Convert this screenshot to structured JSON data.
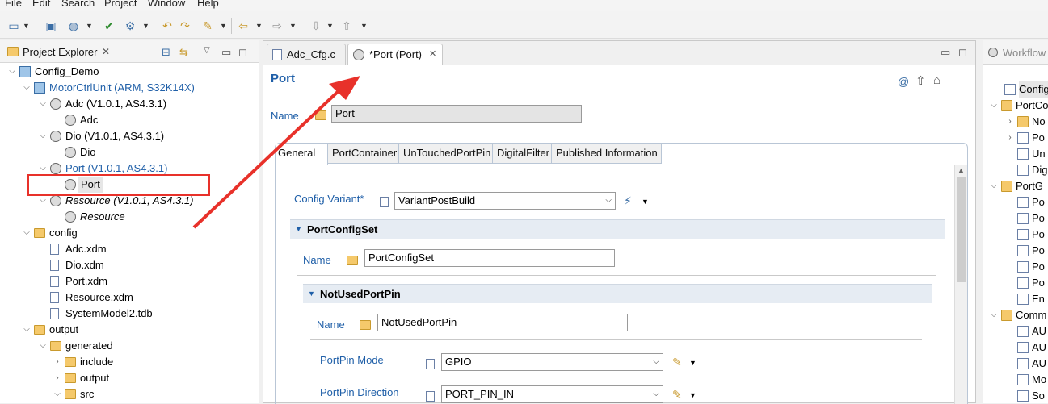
{
  "menu": [
    "File",
    "Edit",
    "Search",
    "Project",
    "Window",
    "Help"
  ],
  "project_explorer": {
    "title": "Project Explorer",
    "tree": [
      {
        "label": "Config_Demo",
        "depth": 0,
        "twisty": "open",
        "icon": "project",
        "color": "#000"
      },
      {
        "label": "MotorCtrlUnit (ARM, S32K14X)",
        "depth": 1,
        "twisty": "open",
        "icon": "ecu",
        "color": "#1f5fa8"
      },
      {
        "label": "Adc (V1.0.1, AS4.3.1)",
        "depth": 2,
        "twisty": "open",
        "icon": "module",
        "color": "#000"
      },
      {
        "label": "Adc",
        "depth": 3,
        "twisty": "",
        "icon": "config",
        "color": "#000"
      },
      {
        "label": "Dio (V1.0.1, AS4.3.1)",
        "depth": 2,
        "twisty": "open",
        "icon": "module",
        "color": "#000"
      },
      {
        "label": "Dio",
        "depth": 3,
        "twisty": "",
        "icon": "config",
        "color": "#000"
      },
      {
        "label": "Port (V1.0.1, AS4.3.1)",
        "depth": 2,
        "twisty": "open",
        "icon": "module",
        "color": "#1f5fa8"
      },
      {
        "label": "Port",
        "depth": 3,
        "twisty": "",
        "icon": "config",
        "color": "#000",
        "selected": true
      },
      {
        "label": "Resource (V1.0.1, AS4.3.1)",
        "depth": 2,
        "twisty": "open",
        "icon": "module",
        "color": "#000",
        "italic": true
      },
      {
        "label": "Resource",
        "depth": 3,
        "twisty": "",
        "icon": "config",
        "color": "#000",
        "italic": true
      },
      {
        "label": "config",
        "depth": 1,
        "twisty": "open",
        "icon": "folder",
        "color": "#000"
      },
      {
        "label": "Adc.xdm",
        "depth": 2,
        "twisty": "",
        "icon": "file",
        "color": "#000"
      },
      {
        "label": "Dio.xdm",
        "depth": 2,
        "twisty": "",
        "icon": "file",
        "color": "#000"
      },
      {
        "label": "Port.xdm",
        "depth": 2,
        "twisty": "",
        "icon": "file",
        "color": "#000"
      },
      {
        "label": "Resource.xdm",
        "depth": 2,
        "twisty": "",
        "icon": "file",
        "color": "#000"
      },
      {
        "label": "SystemModel2.tdb",
        "depth": 2,
        "twisty": "",
        "icon": "file",
        "color": "#000"
      },
      {
        "label": "output",
        "depth": 1,
        "twisty": "open",
        "icon": "folder",
        "color": "#000"
      },
      {
        "label": "generated",
        "depth": 2,
        "twisty": "open",
        "icon": "folder",
        "color": "#000"
      },
      {
        "label": "include",
        "depth": 3,
        "twisty": "closed",
        "icon": "folder",
        "color": "#000"
      },
      {
        "label": "output",
        "depth": 3,
        "twisty": "closed",
        "icon": "folder",
        "color": "#000"
      },
      {
        "label": "src",
        "depth": 3,
        "twisty": "open",
        "icon": "folder",
        "color": "#000"
      }
    ]
  },
  "editor": {
    "tabs": [
      {
        "label": "Adc_Cfg.c",
        "active": false
      },
      {
        "label": "*Port (Port)",
        "active": true
      }
    ],
    "title": "Port",
    "name_label": "Name",
    "name_value": "Port",
    "subtabs": [
      "General",
      "PortContainer",
      "UnTouchedPortPin",
      "DigitalFilter",
      "Published Information"
    ],
    "config_variant_label": "Config Variant*",
    "config_variant_value": "VariantPostBuild",
    "portconfigset_header": "PortConfigSet",
    "portconfigset_name_label": "Name",
    "portconfigset_name_value": "PortConfigSet",
    "notused_header": "NotUsedPortPin",
    "notused_name_label": "Name",
    "notused_name_value": "NotUsedPortPin",
    "pin_mode_label": "PortPin Mode",
    "pin_mode_value": "GPIO",
    "pin_dir_label": "PortPin Direction",
    "pin_dir_value": "PORT_PIN_IN"
  },
  "workflow": {
    "title": "Workflow",
    "items": [
      "Config",
      "PortCo",
      "No",
      "Po",
      "Un",
      "Dig",
      "PortG",
      "Po",
      "Po",
      "Po",
      "Po",
      "Po",
      "Po",
      "En",
      "Comm",
      "AU",
      "AU",
      "AU",
      "Mo",
      "So"
    ]
  },
  "colors": {
    "accent": "#1f5fa8",
    "annotation": "#e8312a"
  }
}
